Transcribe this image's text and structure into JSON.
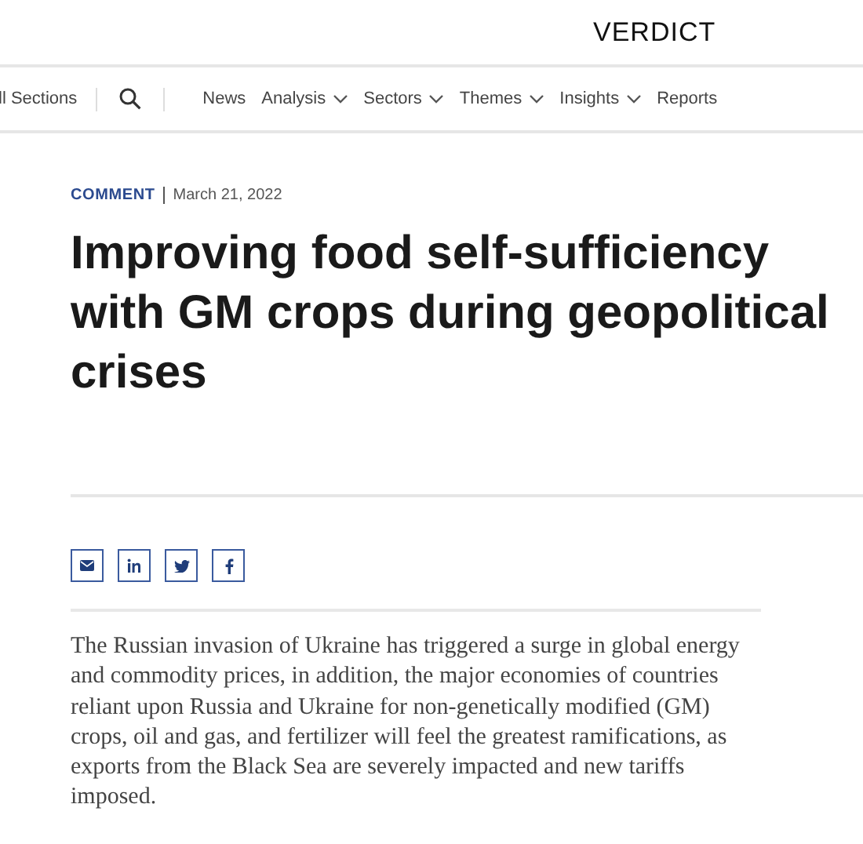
{
  "logo": "VERDICT",
  "nav": {
    "sections_link": "ll Sections",
    "items": [
      {
        "label": "News",
        "dropdown": false
      },
      {
        "label": "Analysis",
        "dropdown": true
      },
      {
        "label": "Sectors",
        "dropdown": true
      },
      {
        "label": "Themes",
        "dropdown": true
      },
      {
        "label": "Insights",
        "dropdown": true
      },
      {
        "label": "Reports",
        "dropdown": false
      }
    ]
  },
  "article": {
    "category": "COMMENT",
    "date": "March 21, 2022",
    "title": "Improving food self-sufficiency with GM crops during geopolitical crises",
    "share": [
      {
        "kind": "email"
      },
      {
        "kind": "linkedin"
      },
      {
        "kind": "twitter"
      },
      {
        "kind": "facebook"
      }
    ],
    "lead": "The Russian invasion of Ukraine has triggered a surge in global energy and commodity prices, in addition, the major economies of countries reliant upon Russia and Ukraine for non-genetically modified (GM) crops, oil and gas, and fertilizer will feel the greatest ramifications, as exports from the Black Sea are severely impacted and new tariffs imposed."
  }
}
